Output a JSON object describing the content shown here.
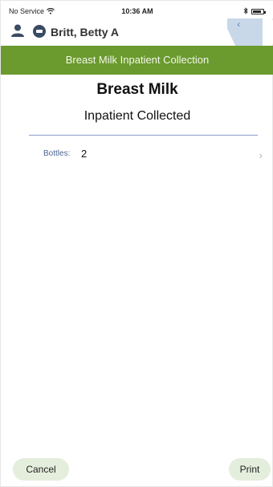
{
  "status_bar": {
    "carrier": "No Service",
    "time": "10:36 AM"
  },
  "patient": {
    "name": "Britt, Betty A"
  },
  "header": {
    "title": "Breast Milk Inpatient Collection"
  },
  "main": {
    "heading": "Breast Milk",
    "subheading": "Inpatient Collected",
    "bottles_label": "Bottles:",
    "bottles_value": "2"
  },
  "footer": {
    "cancel_label": "Cancel",
    "print_label": "Print"
  },
  "colors": {
    "header_green": "#6b9a2e",
    "button_bg": "#e4eedc",
    "label_blue": "#4c6493"
  }
}
